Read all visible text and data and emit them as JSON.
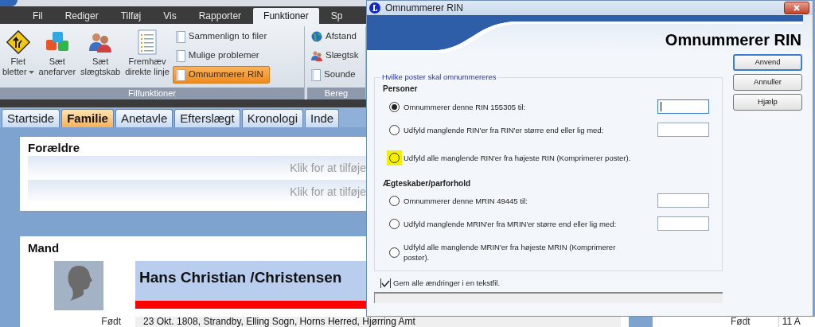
{
  "app": {
    "menu_tabs": [
      {
        "label": "Fil",
        "selected": false
      },
      {
        "label": "Rediger",
        "selected": false
      },
      {
        "label": "Tilføj",
        "selected": false
      },
      {
        "label": "Vis",
        "selected": false
      },
      {
        "label": "Rapporter",
        "selected": false
      },
      {
        "label": "Funktioner",
        "selected": true
      },
      {
        "label": "Sp",
        "selected": false
      }
    ],
    "ribbon_groups": [
      {
        "label": "Filfunktioner",
        "large_buttons": [
          {
            "lines": [
              "Flet",
              "bletter"
            ],
            "dropdown": true
          },
          {
            "lines": [
              "Sæt",
              "anefarver"
            ],
            "dropdown": false
          },
          {
            "lines": [
              "Sæt",
              "slægtskab"
            ],
            "dropdown": false
          },
          {
            "lines": [
              "Fremhæv",
              "direkte linje"
            ],
            "dropdown": false
          }
        ],
        "small_buttons": [
          {
            "label": "Sammenlign to filer",
            "selected": false
          },
          {
            "label": "Mulige problemer",
            "selected": false
          },
          {
            "label": "Omnummerer RIN",
            "selected": true
          }
        ]
      },
      {
        "label": "Bereg",
        "small_buttons": [
          {
            "label": "Afstand",
            "selected": false
          },
          {
            "label": "Slægtsk",
            "selected": false
          },
          {
            "label": "Sounde",
            "selected": false
          }
        ]
      }
    ],
    "page_tabs": [
      {
        "label": "Startside",
        "selected": false
      },
      {
        "label": "Familie",
        "selected": true
      },
      {
        "label": "Anetavle",
        "selected": false
      },
      {
        "label": "Efterslægt",
        "selected": false
      },
      {
        "label": "Kronologi",
        "selected": false
      },
      {
        "label": "Inde",
        "selected": false
      }
    ],
    "parents_card": {
      "title": "Forældre",
      "rows": [
        "Klik for at tilføje",
        "Klik for at tilføje"
      ]
    },
    "spouse_card": {
      "title": "Mand",
      "name": "Hans Christian /Christensen",
      "born_label": "Født",
      "born_value": "23 Okt. 1808, Strandby, Elling Sogn, Horns Herred, Hjørring Amt"
    },
    "side_panel": {
      "born_label": "Født",
      "born_value": "11 A"
    }
  },
  "dialog": {
    "title": "Omnummerer RIN",
    "header_title": "Omnummerer RIN",
    "group_legend": "Hvilke poster skal omnummereres",
    "sections": [
      {
        "heading": "Personer",
        "options": [
          {
            "label": "Omnummerer denne RIN 155305 til:",
            "selected": true,
            "highlighted": false,
            "field": {
              "focused": true
            }
          },
          {
            "label": "Udfyld manglende RIN'er fra RIN'er større end eller lig med:",
            "selected": false,
            "highlighted": false,
            "field": {
              "focused": false
            }
          },
          {
            "label": "Udfyld alle manglende RIN'er fra højeste RIN (Komprimerer poster).",
            "selected": false,
            "highlighted": true
          }
        ]
      },
      {
        "heading": "Ægteskaber/parforhold",
        "options": [
          {
            "label": "Omnummerer denne MRIN 49445 til:",
            "selected": false,
            "highlighted": false,
            "field": {
              "focused": false
            }
          },
          {
            "label": "Udfyld manglende MRIN'er fra MRIN'er større end eller lig med:",
            "selected": false,
            "highlighted": false,
            "field": {
              "focused": false
            }
          },
          {
            "label": "Udfyld alle manglende MRIN'er fra højeste MRIN (Komprimerer poster).",
            "selected": false,
            "highlighted": false
          }
        ]
      }
    ],
    "save_checkbox": {
      "label": "Gem alle ændringer i en tekstfil.",
      "checked": true
    },
    "progress": {
      "level": 0
    },
    "buttons": [
      {
        "label": "Anvend",
        "default": true
      },
      {
        "label": "Annuller",
        "default": false
      },
      {
        "label": "Hjælp",
        "default": false
      }
    ]
  }
}
